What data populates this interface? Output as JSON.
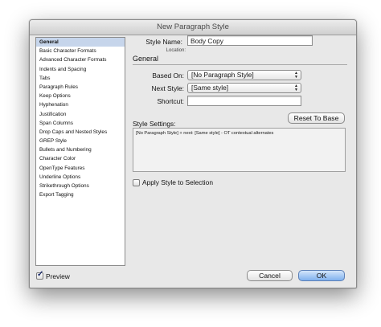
{
  "window": {
    "title": "New Paragraph Style"
  },
  "sidebar": {
    "items": [
      {
        "label": "General",
        "selected": true
      },
      {
        "label": "Basic Character Formats"
      },
      {
        "label": "Advanced Character Formats"
      },
      {
        "label": "Indents and Spacing"
      },
      {
        "label": "Tabs"
      },
      {
        "label": "Paragraph Rules"
      },
      {
        "label": "Keep Options"
      },
      {
        "label": "Hyphenation"
      },
      {
        "label": "Justification"
      },
      {
        "label": "Span Columns"
      },
      {
        "label": "Drop Caps and Nested Styles"
      },
      {
        "label": "GREP Style"
      },
      {
        "label": "Bullets and Numbering"
      },
      {
        "label": "Character Color"
      },
      {
        "label": "OpenType Features"
      },
      {
        "label": "Underline Options"
      },
      {
        "label": "Strikethrough Options"
      },
      {
        "label": "Export Tagging"
      }
    ]
  },
  "main": {
    "style_name_label": "Style Name:",
    "style_name_value": "Body Copy",
    "location_label": "Location:",
    "section_title": "General",
    "based_on_label": "Based On:",
    "based_on_value": "[No Paragraph Style]",
    "next_style_label": "Next Style:",
    "next_style_value": "[Same style]",
    "shortcut_label": "Shortcut:",
    "shortcut_value": "",
    "reset_button": "Reset To Base",
    "settings_label": "Style Settings:",
    "settings_text": "[No Paragraph Style] + next: [Same style] - OT contextual alternates",
    "apply_label": "Apply Style to Selection",
    "apply_checked": false
  },
  "footer": {
    "preview_label": "Preview",
    "preview_checked": true,
    "cancel_button": "Cancel",
    "ok_button": "OK"
  },
  "colors": {
    "selection": "#c6d5eb",
    "default_button": "#7fb1ee"
  },
  "icons": [
    "chevron-updown-icon",
    "checkmark-icon"
  ]
}
